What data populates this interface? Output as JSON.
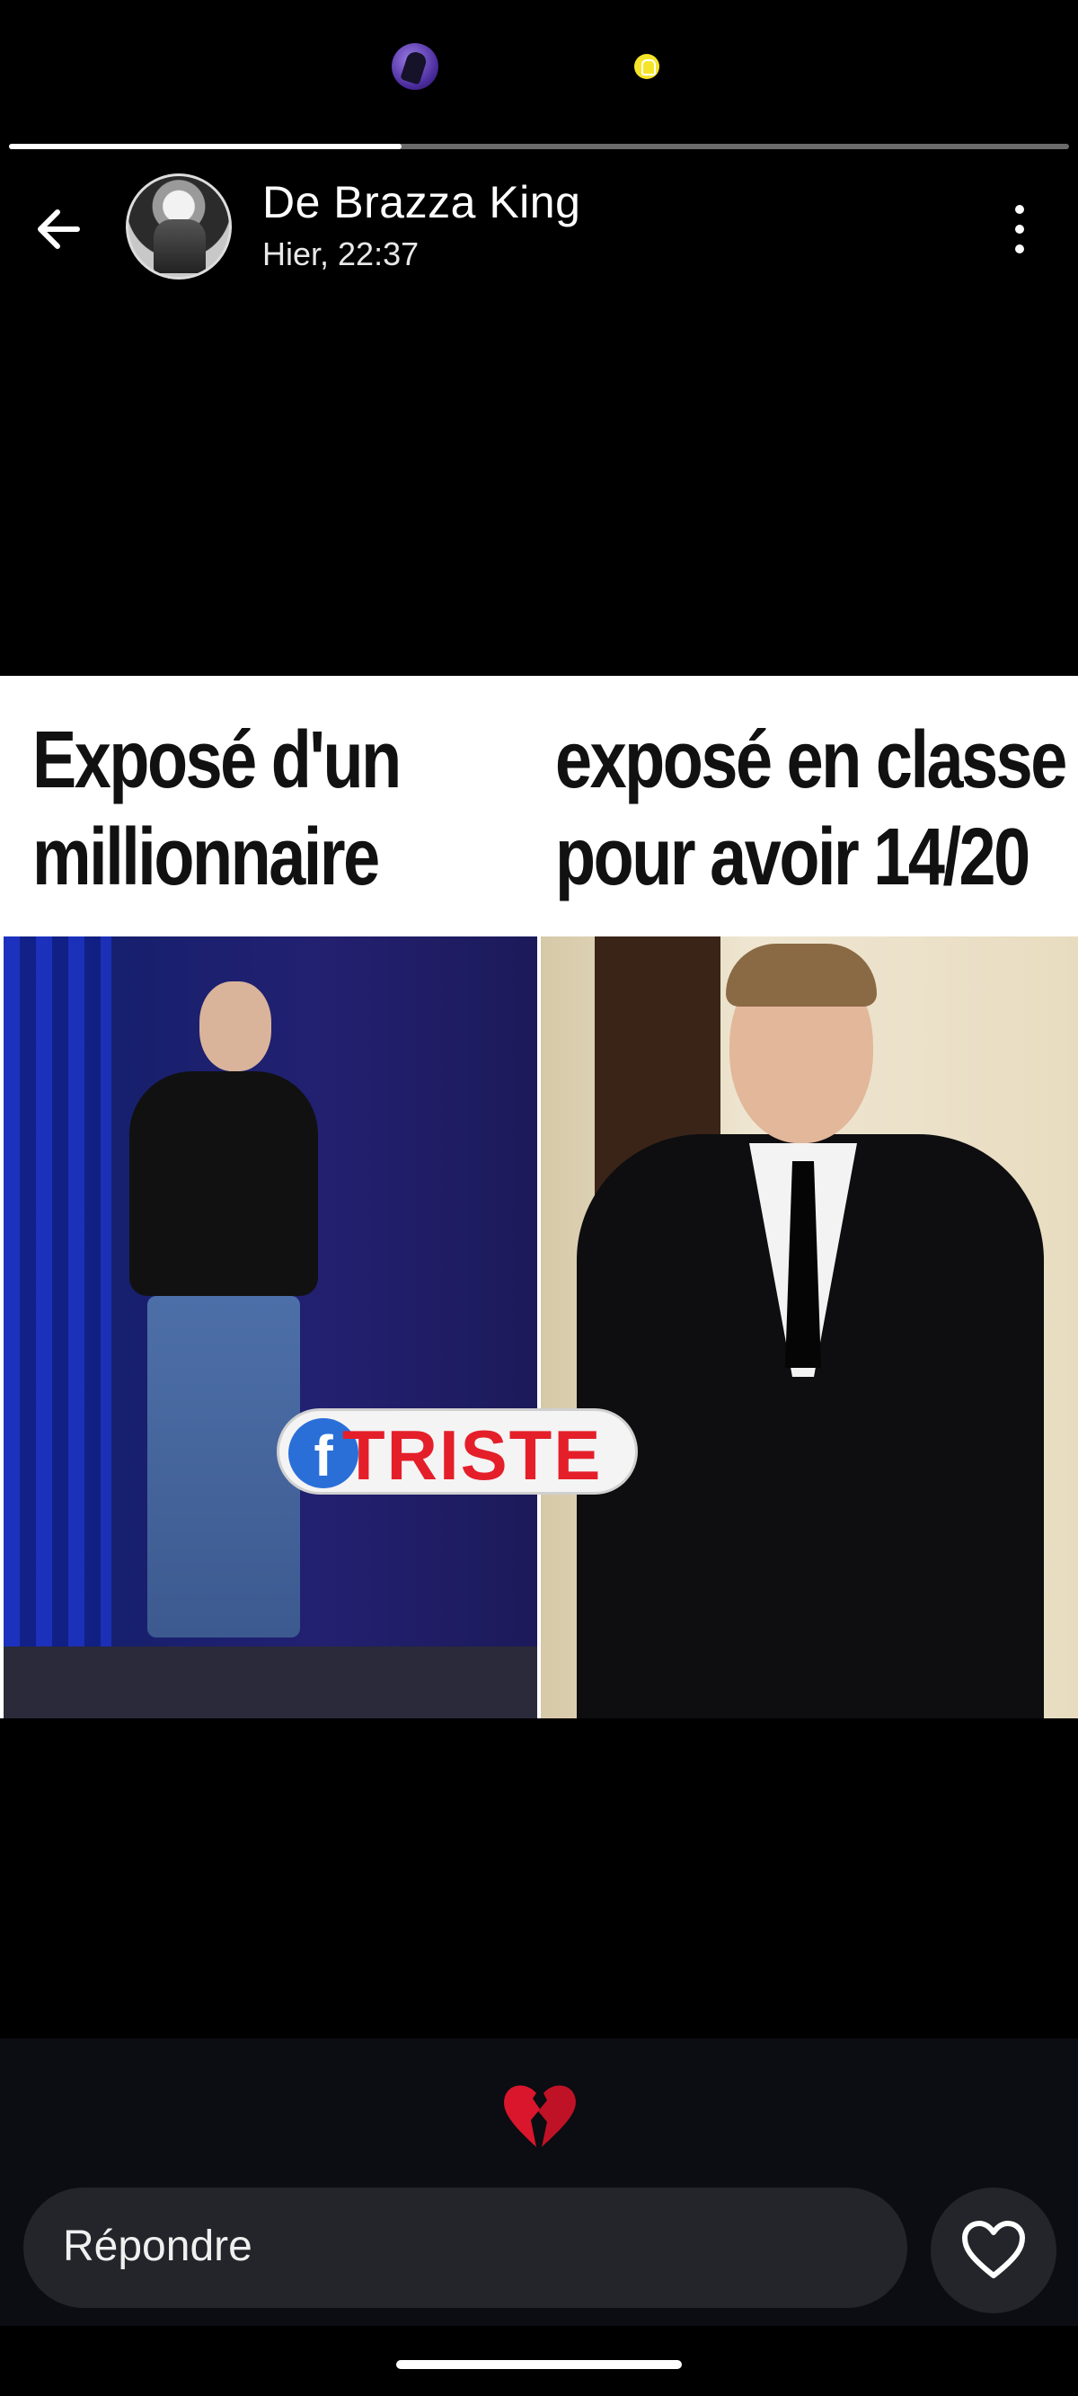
{
  "story": {
    "progress": 0.37
  },
  "header": {
    "contact_name": "De Brazza King",
    "timestamp": "Hier, 22:37"
  },
  "media": {
    "caption_left": "Exposé d'un millionnaire",
    "caption_right": "exposé en classe pour avoir 14/20",
    "watermark_text": "TRISTE",
    "watermark_logo": "f"
  },
  "reply": {
    "placeholder": "Répondre"
  },
  "icons": {
    "back": "arrow-left-icon",
    "menu": "more-vertical-icon",
    "reaction": "broken-heart-icon",
    "like": "heart-outline-icon"
  },
  "colors": {
    "background": "#000000",
    "reaction_area": "#0b0d12",
    "input_background": "#23252a",
    "broken_heart": "#d9162c"
  }
}
